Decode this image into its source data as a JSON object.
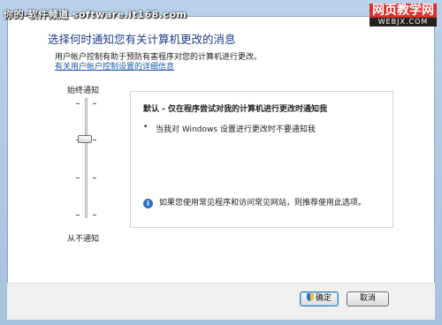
{
  "watermark": {
    "left": "你的·软件频道 software.it168.com",
    "right_big": "网页教学网",
    "right_small": "WEBJX.COM"
  },
  "page": {
    "heading": "选择何时通知您有关计算机更改的消息",
    "description": "用户帐户控制有助于预防有害程序对您的计算机进行更改。",
    "link": "有关用户帐户控制设置的详细信息"
  },
  "slider": {
    "top_label": "始终通知",
    "bottom_label": "从不通知",
    "levels": 4,
    "selected_level": 3
  },
  "panel": {
    "title": "默认 - 仅在程序尝试对我的计算机进行更改时通知我",
    "bullet": "当我对 Windows 设置进行更改时不要通知我",
    "info_icon": "i",
    "info": "如果您使用常见程序和访问常见网站，则推荐使用此选项。"
  },
  "buttons": {
    "ok": "确定",
    "cancel": "取消"
  }
}
